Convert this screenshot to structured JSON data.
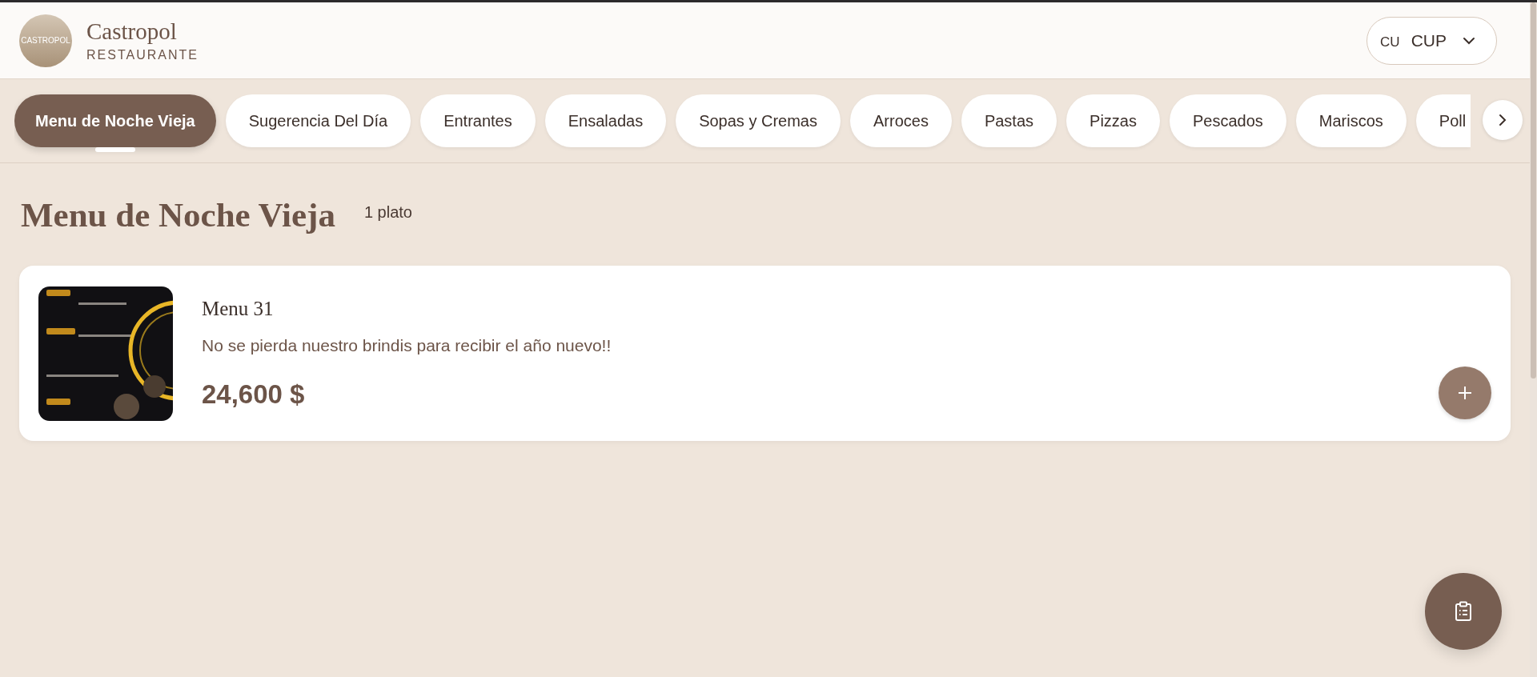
{
  "header": {
    "logo_text": "CASTROPOL",
    "title": "Castropol",
    "subtitle": "RESTAURANTE",
    "currency": {
      "code": "CU",
      "label": "CUP"
    }
  },
  "categories": [
    {
      "label": "Menu de Noche Vieja",
      "selected": true
    },
    {
      "label": "Sugerencia Del Día",
      "selected": false
    },
    {
      "label": "Entrantes",
      "selected": false
    },
    {
      "label": "Ensaladas",
      "selected": false
    },
    {
      "label": "Sopas y Cremas",
      "selected": false
    },
    {
      "label": "Arroces",
      "selected": false
    },
    {
      "label": "Pastas",
      "selected": false
    },
    {
      "label": "Pizzas",
      "selected": false
    },
    {
      "label": "Pescados",
      "selected": false
    },
    {
      "label": "Mariscos",
      "selected": false
    },
    {
      "label": "Poll",
      "selected": false
    }
  ],
  "section": {
    "title": "Menu de Noche Vieja",
    "count": "1 plato"
  },
  "dishes": [
    {
      "kind": "picture",
      "name": "Menu 31",
      "description": "No se pierda nuestro brindis para recibir el año nuevo!!",
      "price": "24,600 $"
    }
  ]
}
